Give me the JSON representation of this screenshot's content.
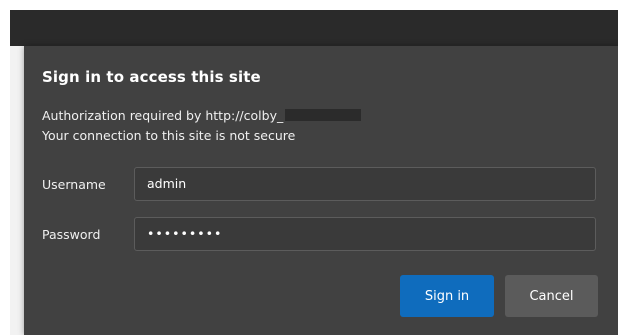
{
  "dialog": {
    "title": "Sign in to access this site",
    "auth_text": "Authorization required by http://colby_",
    "security_note": "Your connection to this site is not secure",
    "username_label": "Username",
    "username_value": "admin",
    "password_label": "Password",
    "password_value": "•••••••••",
    "signin_label": "Sign in",
    "cancel_label": "Cancel"
  },
  "colors": {
    "dialog_bg": "#414141",
    "primary_button": "#0f6cbd",
    "secondary_button": "#5b5b5b"
  }
}
